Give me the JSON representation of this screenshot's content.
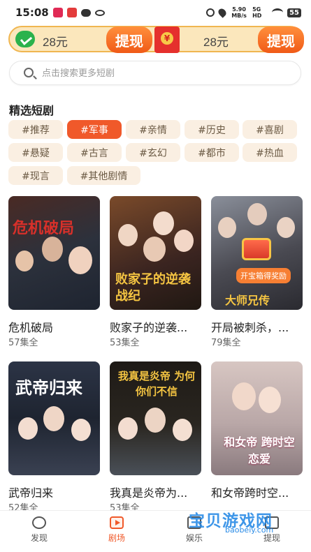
{
  "status_bar": {
    "time": "15:08",
    "speed": "5.90 MB/s",
    "signal": "5G HD",
    "battery": "55"
  },
  "reward_bar": {
    "amount_left": "28元",
    "withdraw_left": "提现",
    "amount_right": "28元",
    "withdraw_right": "提现",
    "redpack_symbol": "¥"
  },
  "search": {
    "placeholder": "点击搜索更多短剧"
  },
  "section": {
    "title": "精选短剧"
  },
  "tags": [
    {
      "label": "#推荐",
      "active": false
    },
    {
      "label": "#军事",
      "active": true
    },
    {
      "label": "#亲情",
      "active": false
    },
    {
      "label": "#历史",
      "active": false
    },
    {
      "label": "#喜剧",
      "active": false
    },
    {
      "label": "#悬疑",
      "active": false
    },
    {
      "label": "#古言",
      "active": false
    },
    {
      "label": "#玄幻",
      "active": false
    },
    {
      "label": "#都市",
      "active": false
    },
    {
      "label": "#热血",
      "active": false
    },
    {
      "label": "#现言",
      "active": false
    },
    {
      "label": "#其他剧情",
      "active": false
    }
  ],
  "dramas": [
    {
      "title": "危机破局",
      "episodes": "57集全",
      "poster_text": "危机破局",
      "poster_color": "#3a3f4a"
    },
    {
      "title": "败家子的逆袭...",
      "episodes": "53集全",
      "poster_text": "败家子的逆袭战纪",
      "poster_color": "#6a3a2a"
    },
    {
      "title": "开局被刺杀，...",
      "episodes": "79集全",
      "poster_text": "大师兄传",
      "poster_color": "#4a4a52",
      "badge": "开宝箱得奖励"
    },
    {
      "title": "武帝归来",
      "episodes": "52集全",
      "poster_text": "武帝归来",
      "poster_color": "#2a3140"
    },
    {
      "title": "我真是炎帝为...",
      "episodes": "53集全",
      "poster_text": "我真是炎帝 为何你们不信",
      "poster_color": "#1e1a16"
    },
    {
      "title": "和女帝跨时空...",
      "episodes": "",
      "poster_text": "和女帝 跨时空恋爱",
      "poster_color": "#d7c6c2"
    }
  ],
  "bottom_nav": [
    {
      "label": "发现",
      "icon": "discover-icon",
      "active": false
    },
    {
      "label": "剧场",
      "icon": "theater-icon",
      "active": true
    },
    {
      "label": "娱乐",
      "icon": "entertainment-icon",
      "active": false
    },
    {
      "label": "提现",
      "icon": "withdraw-icon",
      "active": false
    }
  ],
  "watermark": {
    "text": "宝贝游戏网",
    "sub": "baobeiy.com"
  },
  "colors": {
    "accent": "#f0592a",
    "tag_bg": "#faefe2",
    "reward_bg": "#fbe7bc"
  }
}
